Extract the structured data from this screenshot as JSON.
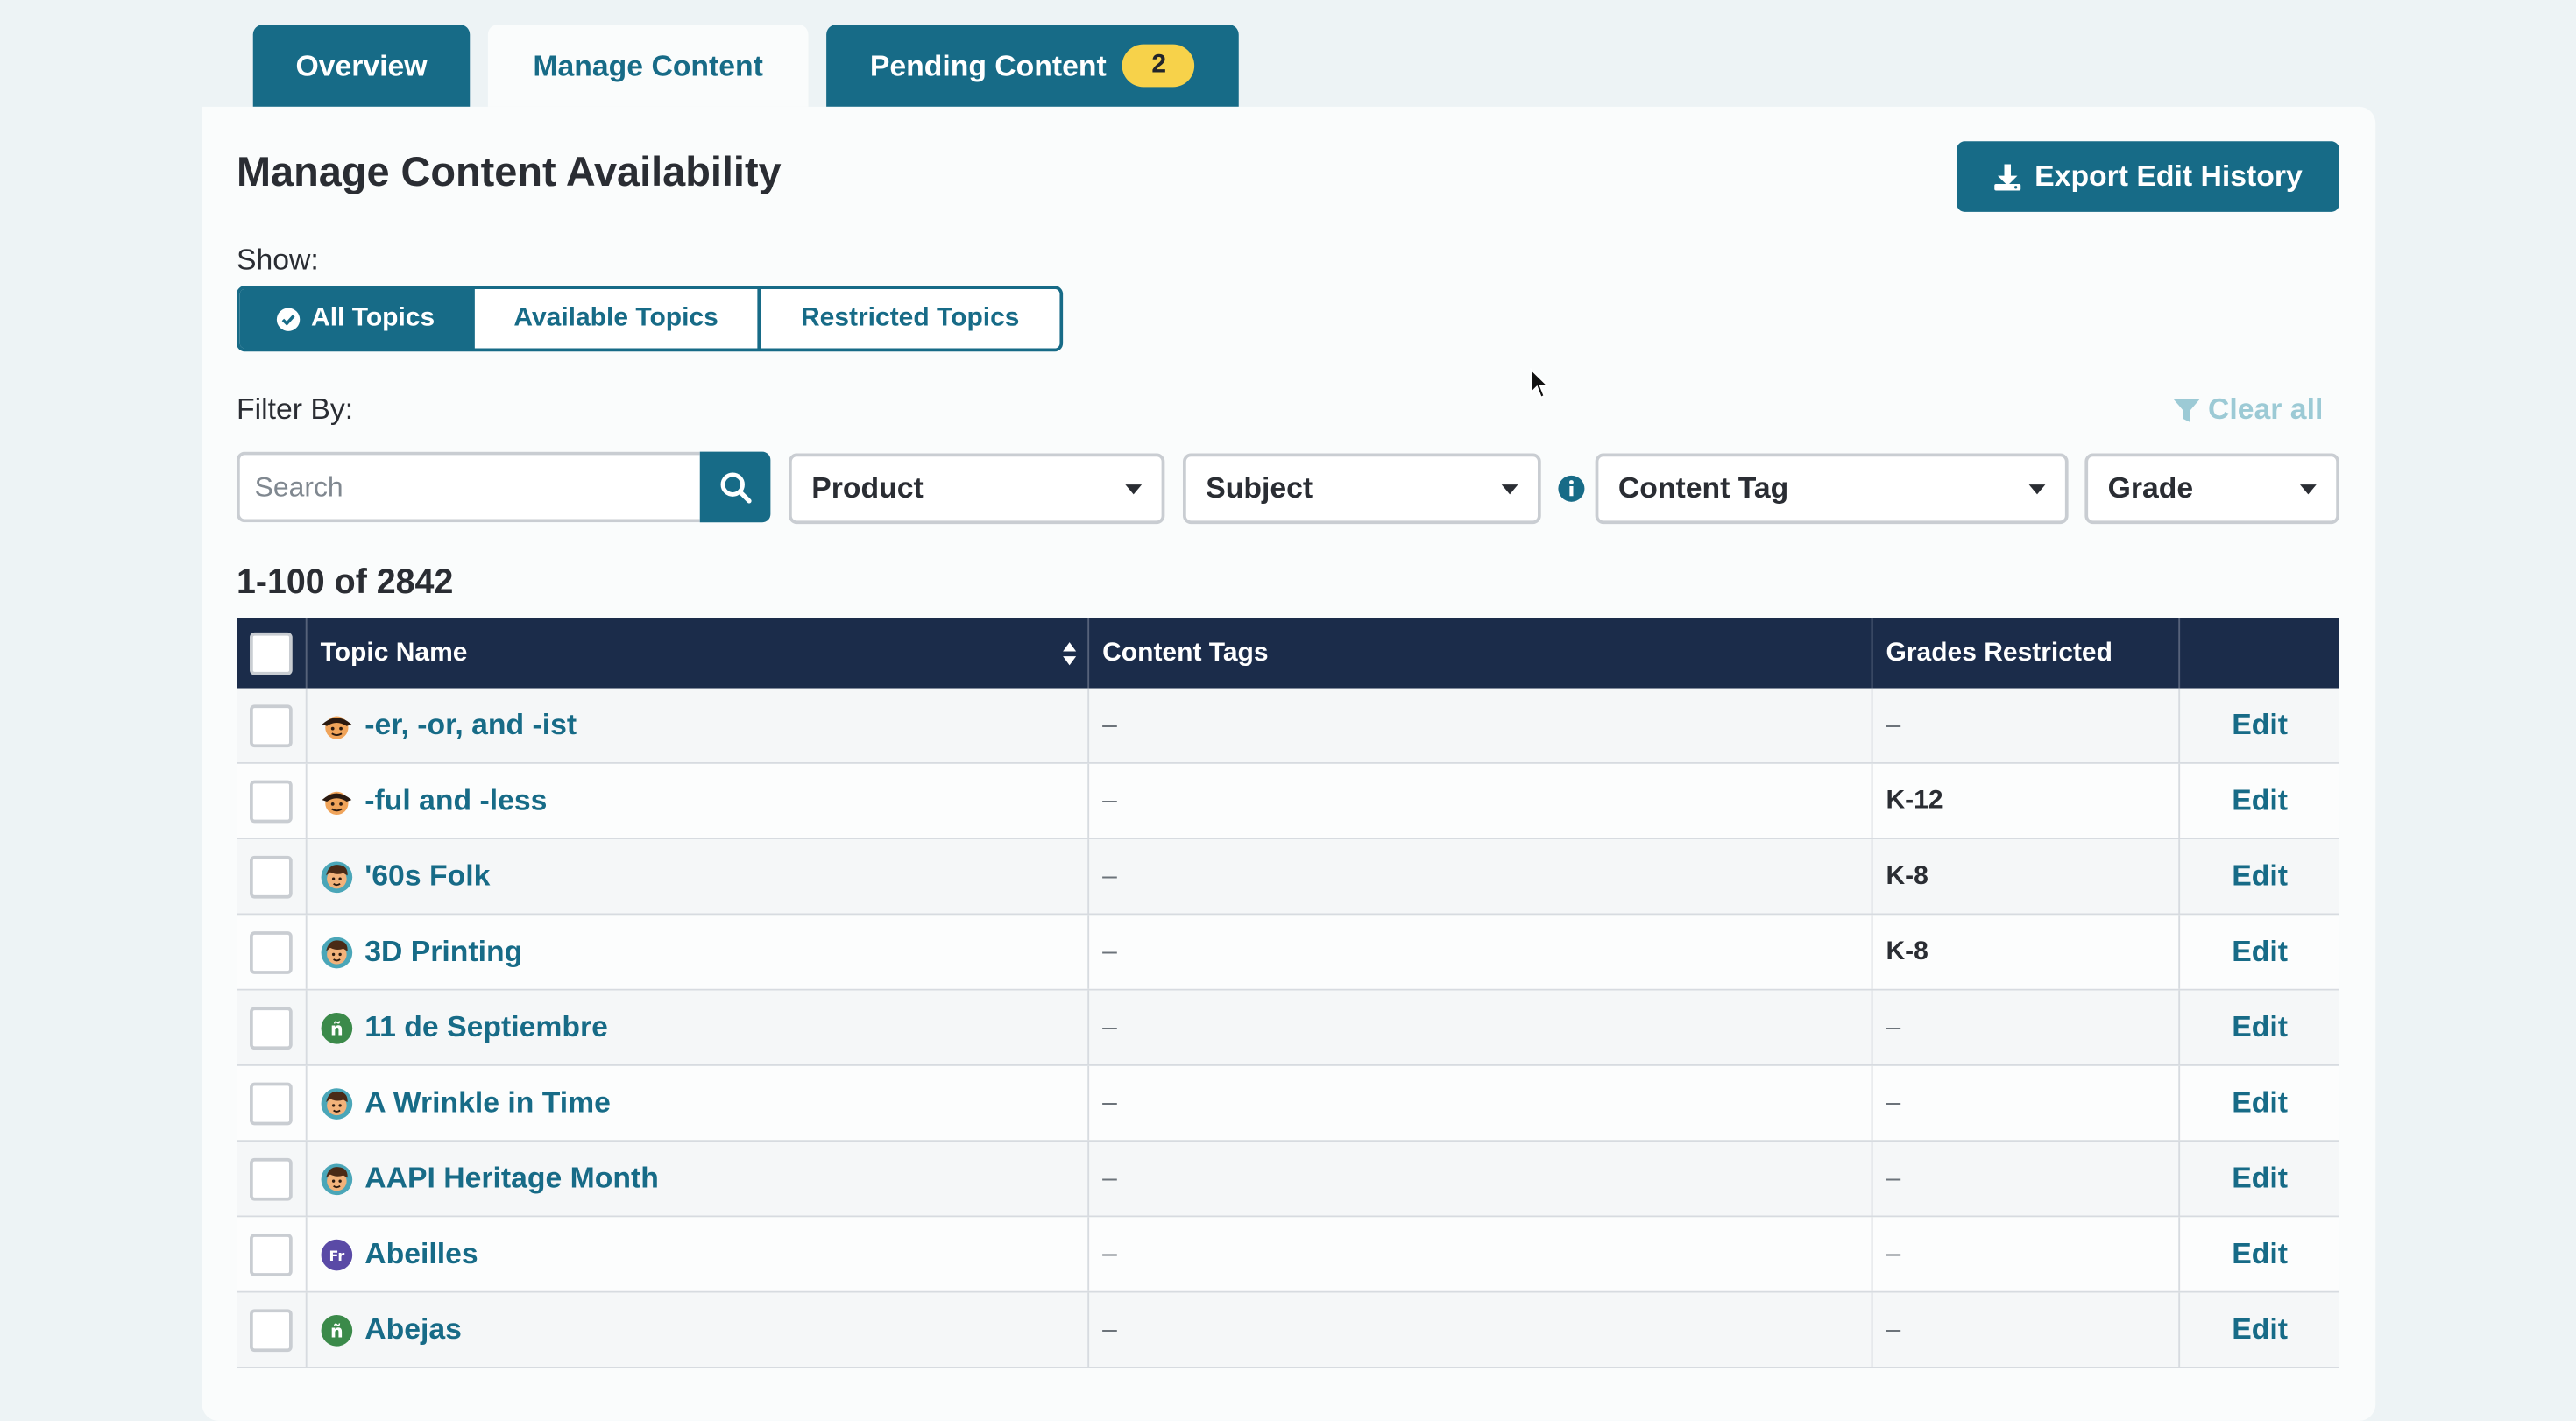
{
  "tabs": {
    "overview": "Overview",
    "manage": "Manage Content",
    "pending": "Pending Content",
    "pending_count": "2"
  },
  "panel": {
    "title": "Manage Content Availability",
    "export_label": "Export Edit History",
    "show_label": "Show:",
    "show_options": [
      "All Topics",
      "Available Topics",
      "Restricted Topics"
    ],
    "filter_label": "Filter By:",
    "clear_all": "Clear all",
    "search_placeholder": "Search",
    "product_label": "Product",
    "subject_label": "Subject",
    "content_tag_label": "Content Tag",
    "grade_label": "Grade",
    "count_label": "1-100 of 2842"
  },
  "table": {
    "headers": {
      "topic": "Topic Name",
      "tags": "Content Tags",
      "grades": "Grades Restricted"
    },
    "rows": [
      {
        "name": "-er, -or, and -ist",
        "avatar": "jr-avatar-icon",
        "tags": "–",
        "grades": "–",
        "edit": "Edit"
      },
      {
        "name": "-ful and -less",
        "avatar": "jr-avatar-icon",
        "tags": "–",
        "grades": "K-12",
        "edit": "Edit"
      },
      {
        "name": "'60s Folk",
        "avatar": "boy-avatar-icon",
        "tags": "–",
        "grades": "K-8",
        "edit": "Edit"
      },
      {
        "name": "3D Printing",
        "avatar": "boy-avatar-icon",
        "tags": "–",
        "grades": "K-8",
        "edit": "Edit"
      },
      {
        "name": "11 de Septiembre",
        "avatar": "spanish-avatar-icon",
        "tags": "–",
        "grades": "–",
        "edit": "Edit"
      },
      {
        "name": "A Wrinkle in Time",
        "avatar": "boy-avatar-icon",
        "tags": "–",
        "grades": "–",
        "edit": "Edit"
      },
      {
        "name": "AAPI Heritage Month",
        "avatar": "boy-avatar-icon",
        "tags": "–",
        "grades": "–",
        "edit": "Edit"
      },
      {
        "name": "Abeilles",
        "avatar": "french-avatar-icon",
        "tags": "–",
        "grades": "–",
        "edit": "Edit"
      },
      {
        "name": "Abejas",
        "avatar": "spanish-avatar-icon",
        "tags": "–",
        "grades": "–",
        "edit": "Edit"
      }
    ]
  },
  "colors": {
    "accent": "#176b87",
    "header_bg": "#1b2c4a",
    "badge": "#f7d24a",
    "clear_all": "#9ccad5"
  }
}
